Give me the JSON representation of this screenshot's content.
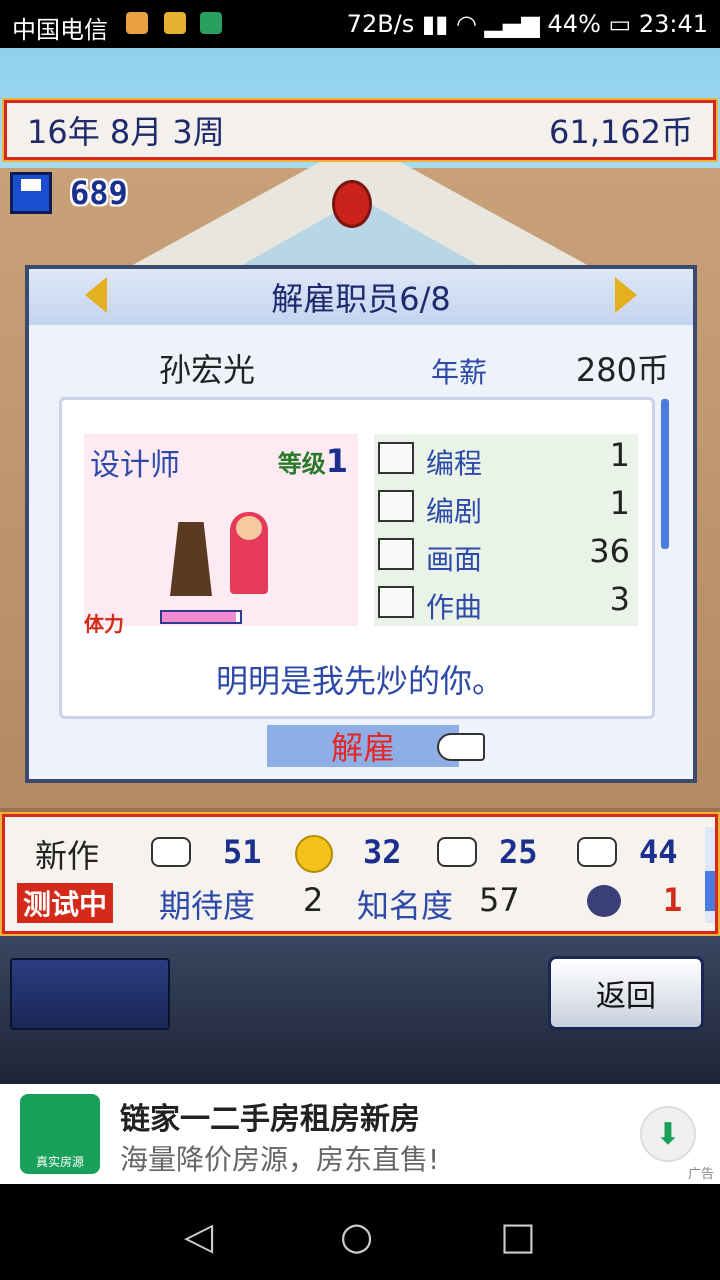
{
  "status_bar": {
    "carrier": "中国电信",
    "network": "72B/s",
    "battery": "44%",
    "time": "23:41"
  },
  "top_bar": {
    "date": "16年 8月 3周",
    "money": "61,162币"
  },
  "save": {
    "count": "689"
  },
  "dialog": {
    "title": "解雇职员6/8",
    "staff_name": "孙宏光",
    "salary_label": "年薪",
    "salary_value": "280币",
    "role": "设计师",
    "level_label": "等级",
    "level": "1",
    "stamina_label": "体力",
    "stamina_fraction": 0.95,
    "stats": [
      {
        "icon": "computer-icon",
        "label": "编程",
        "value": "1"
      },
      {
        "icon": "book-icon",
        "label": "编剧",
        "value": "1"
      },
      {
        "icon": "palette-icon",
        "label": "画面",
        "value": "36"
      },
      {
        "icon": "trumpet-icon",
        "label": "作曲",
        "value": "3"
      }
    ],
    "quote": "明明是我先炒的你。",
    "fire_button": "解雇"
  },
  "info_bar": {
    "new_work_label": "新作",
    "fun": "51",
    "originality": "32",
    "graphics": "25",
    "sound": "44",
    "status_label": "测试中",
    "expectation_label": "期待度",
    "expectation": "2",
    "fame_label": "知名度",
    "fame": "57",
    "bugs": "1"
  },
  "back_button": "返回",
  "ad": {
    "title": "链家一二手房租房新房",
    "subtitle": "海量降价房源，房东直售!",
    "logo_text": "真实房源",
    "tag": "广告"
  }
}
